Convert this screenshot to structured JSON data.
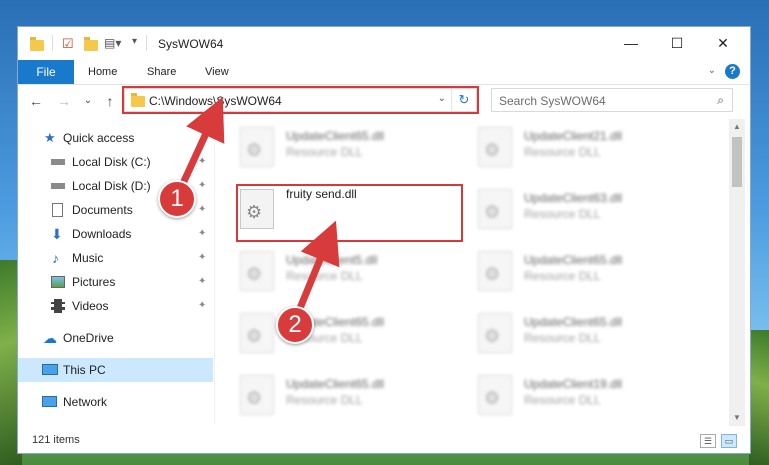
{
  "window": {
    "title": "SysWOW64",
    "minimize_glyph": "—",
    "maximize_glyph": "☐",
    "close_glyph": "✕"
  },
  "ribbon": {
    "tabs": [
      "File",
      "Home",
      "Share",
      "View"
    ],
    "help": "?",
    "collapse": "⌄"
  },
  "navigation": {
    "back": "←",
    "forward": "→",
    "recent": "⌄",
    "up": "↑",
    "address": "C:\\Windows\\SysWOW64",
    "address_dropdown": "⌄",
    "refresh": "↻",
    "search_placeholder": "Search SysWOW64",
    "search_icon": "⌕"
  },
  "sidebar": {
    "items": [
      {
        "label": "Quick access",
        "icon": "star-icon",
        "pinned": false
      },
      {
        "label": "Local Disk (C:)",
        "icon": "drive-icon",
        "pinned": true
      },
      {
        "label": "Local Disk (D:)",
        "icon": "drive-icon",
        "pinned": true
      },
      {
        "label": "Documents",
        "icon": "documents-icon",
        "pinned": true
      },
      {
        "label": "Downloads",
        "icon": "download-icon",
        "pinned": true
      },
      {
        "label": "Music",
        "icon": "music-icon",
        "pinned": true
      },
      {
        "label": "Pictures",
        "icon": "pictures-icon",
        "pinned": true
      },
      {
        "label": "Videos",
        "icon": "videos-icon",
        "pinned": true
      },
      {
        "label": "OneDrive",
        "icon": "cloud-icon",
        "pinned": false
      },
      {
        "label": "This PC",
        "icon": "computer-icon",
        "pinned": false,
        "selected": true
      },
      {
        "label": "Network",
        "icon": "network-icon",
        "pinned": false
      }
    ],
    "pin_glyph": "📌"
  },
  "files": {
    "left": [
      {
        "name": "UpdateClient65.dll",
        "type": "Resource DLL"
      },
      {
        "name": "fruity send.dll",
        "type": ""
      },
      {
        "name": "UpdateClient5.dll",
        "type": "Resource DLL"
      },
      {
        "name": "UpdateClient65.dll",
        "type": "Resource DLL"
      },
      {
        "name": "UpdateClient65.dll",
        "type": "Resource DLL"
      }
    ],
    "right": [
      {
        "name": "UpdateClient21.dll",
        "type": "Resource DLL"
      },
      {
        "name": "UpdateClient63.dll",
        "type": "Resource DLL"
      },
      {
        "name": "UpdateClient65.dll",
        "type": "Resource DLL"
      },
      {
        "name": "UpdateClient65.dll",
        "type": "Resource DLL"
      },
      {
        "name": "UpdateClient19.dll",
        "type": "Resource DLL"
      }
    ]
  },
  "status": {
    "item_count": "121 items"
  },
  "annotations": {
    "step1": "1",
    "step2": "2",
    "color": "#d9383a"
  },
  "colors": {
    "accent": "#1979ca",
    "selected_bg": "#cce8ff",
    "callout": "#d83b3b"
  }
}
